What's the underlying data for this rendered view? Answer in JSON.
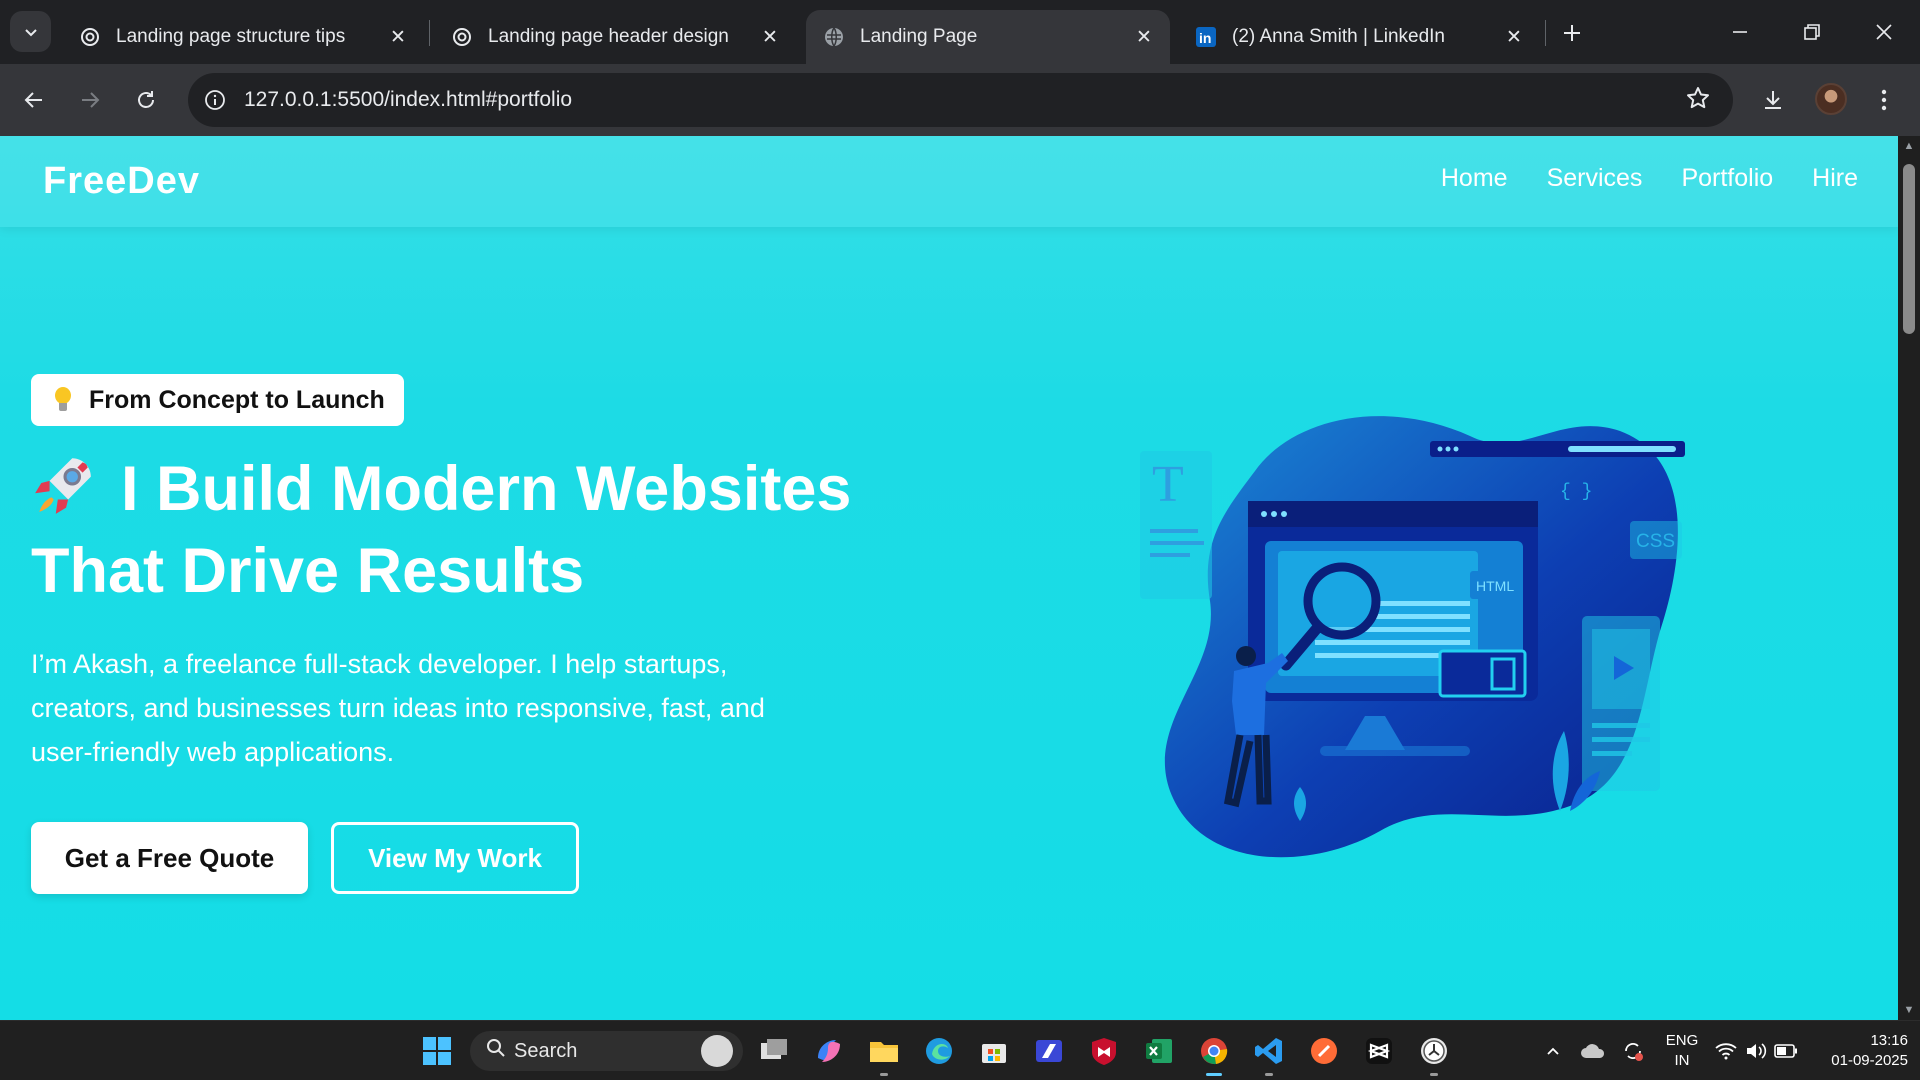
{
  "browser": {
    "tabs": [
      {
        "title": "Landing page structure tips",
        "icon": "chatgpt-icon",
        "active": false
      },
      {
        "title": "Landing page header design",
        "icon": "chatgpt-icon",
        "active": false
      },
      {
        "title": "Landing Page",
        "icon": "globe-icon",
        "active": true
      },
      {
        "title": "(2) Anna Smith | LinkedIn",
        "icon": "linkedin-icon",
        "active": false
      }
    ],
    "url": "127.0.0.1:5500/index.html#portfolio"
  },
  "site": {
    "logo": "FreeDev",
    "nav": [
      "Home",
      "Services",
      "Portfolio",
      "Hire"
    ],
    "hero": {
      "badge": "From Concept to Launch",
      "headline_line1": "I Build Modern Websites",
      "headline_line2": "That Drive Results",
      "intro": "I’m Akash, a freelance full-stack developer. I help startups, creators, and businesses turn ideas into responsive, fast, and user-friendly web applications.",
      "cta_primary": "Get a Free Quote",
      "cta_secondary": "View My Work",
      "illustration_labels": {
        "t": "T",
        "html": "HTML",
        "css": "CSS",
        "braces": "{ }"
      }
    },
    "colors": {
      "background": "#1ddbe5",
      "accent": "#0b2fa8"
    }
  },
  "taskbar": {
    "search_placeholder": "Search",
    "language": "ENG",
    "region": "IN",
    "time": "13:16",
    "date": "01-09-2025"
  }
}
